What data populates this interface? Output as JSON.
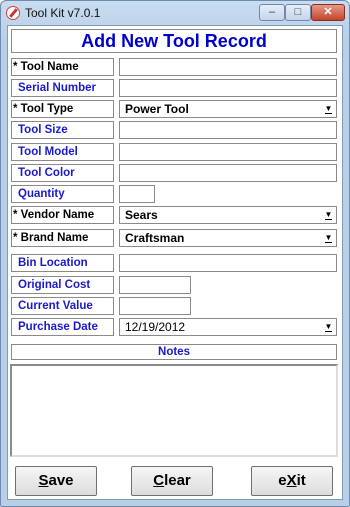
{
  "window": {
    "title": "Tool Kit v7.0.1",
    "controls": {
      "minimize": "–",
      "maximize": "□",
      "close": "✕"
    }
  },
  "form": {
    "title": "Add New Tool Record",
    "fields": {
      "tool_name": {
        "label": "* Tool Name",
        "value": ""
      },
      "serial_number": {
        "label": "Serial Number",
        "value": ""
      },
      "tool_type": {
        "label": "* Tool Type",
        "value": "Power Tool"
      },
      "tool_size": {
        "label": "Tool Size",
        "value": ""
      },
      "tool_model": {
        "label": "Tool Model",
        "value": ""
      },
      "tool_color": {
        "label": "Tool Color",
        "value": ""
      },
      "quantity": {
        "label": "Quantity",
        "value": ""
      },
      "vendor_name": {
        "label": "* Vendor Name",
        "value": "Sears"
      },
      "brand_name": {
        "label": "* Brand Name",
        "value": "Craftsman"
      },
      "bin_location": {
        "label": "Bin Location",
        "value": ""
      },
      "original_cost": {
        "label": "Original Cost",
        "value": ""
      },
      "current_value": {
        "label": "Current Value",
        "value": ""
      },
      "purchase_date": {
        "label": "Purchase Date",
        "value": "12/19/2012"
      }
    },
    "notes": {
      "label": "Notes",
      "value": ""
    },
    "buttons": {
      "save": {
        "mnemonic": "S",
        "rest": "ave"
      },
      "clear": {
        "mnemonic": "C",
        "rest": "lear"
      },
      "exit": {
        "pre": "e",
        "mnemonic": "X",
        "rest": "it"
      }
    }
  },
  "colors": {
    "title_blue": "#0000cc",
    "optional_label_blue": "#1a1acc",
    "frame_blue": "#b9cfe8"
  },
  "icons": {
    "dropdown": "chevron-down-icon",
    "app": "tool-kit-app-icon"
  }
}
